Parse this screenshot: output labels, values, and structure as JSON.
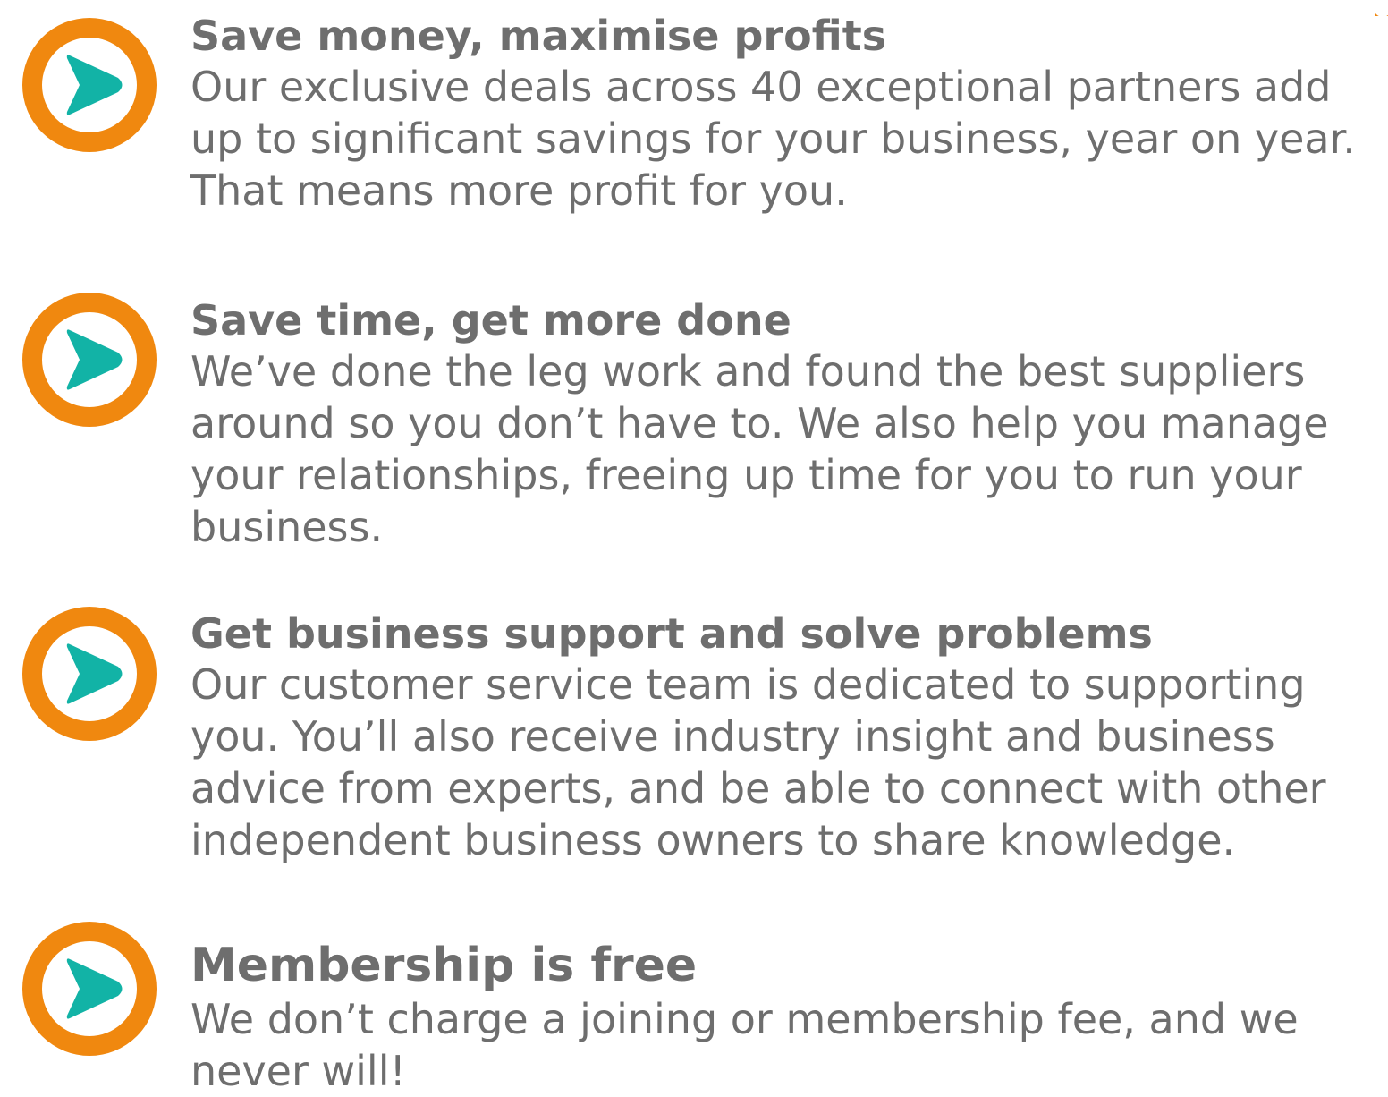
{
  "colors": {
    "ring": "#f0880f",
    "arrow": "#12b3a6",
    "text": "#6e6e6e"
  },
  "items": [
    {
      "icon": "play-arrow-circle-icon",
      "title": "Save money, maximise profits",
      "body": "Our exclusive deals across 40 exceptional partners add up to significant savings for your business, year on year. That means more profit for you."
    },
    {
      "icon": "play-arrow-circle-icon",
      "title": "Save time, get more done",
      "body": "We’ve done the leg work and found the best suppliers around so you don’t have to. We also help you manage your relationships, freeing up time for you to run your business."
    },
    {
      "icon": "play-arrow-circle-icon",
      "title": "Get business support and solve problems",
      "body": "Our customer service team is dedicated to supporting you. You’ll also receive industry insight and business advice from experts, and be able to connect with other independent business owners to share knowledge."
    },
    {
      "icon": "play-arrow-circle-icon",
      "title": "Membership is free",
      "body": "We don’t charge a joining or membership fee, and we never will!"
    }
  ]
}
